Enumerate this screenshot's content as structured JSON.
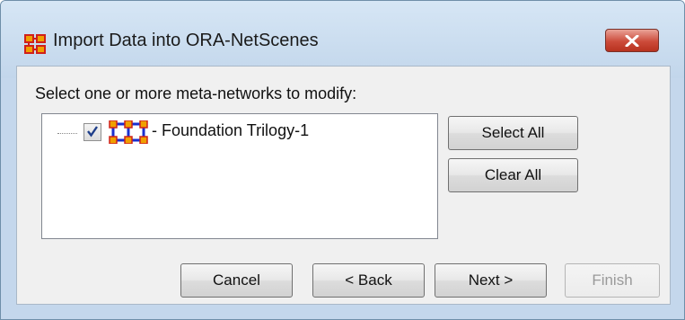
{
  "window": {
    "title": "Import Data into ORA-NetScenes"
  },
  "instruction": "Select one or more meta-networks to modify:",
  "list": {
    "items": [
      {
        "label": "- Foundation Trilogy-1",
        "checked": true,
        "icon": "meta-network-icon"
      }
    ]
  },
  "side_buttons": {
    "select_all": "Select All",
    "clear_all": "Clear All"
  },
  "nav_buttons": {
    "cancel": "Cancel",
    "back": "< Back",
    "next": "Next >",
    "finish": "Finish",
    "finish_enabled": false
  },
  "colors": {
    "titlebar": "#c8dbef",
    "close_button": "#cc4b3a",
    "client": "#f0f0f0",
    "icon_red": "#d0201a",
    "icon_orange": "#f0a000",
    "icon_blue": "#1a2fd0"
  },
  "icons": [
    "app-icon",
    "close-icon",
    "checkbox-icon",
    "meta-network-icon"
  ]
}
